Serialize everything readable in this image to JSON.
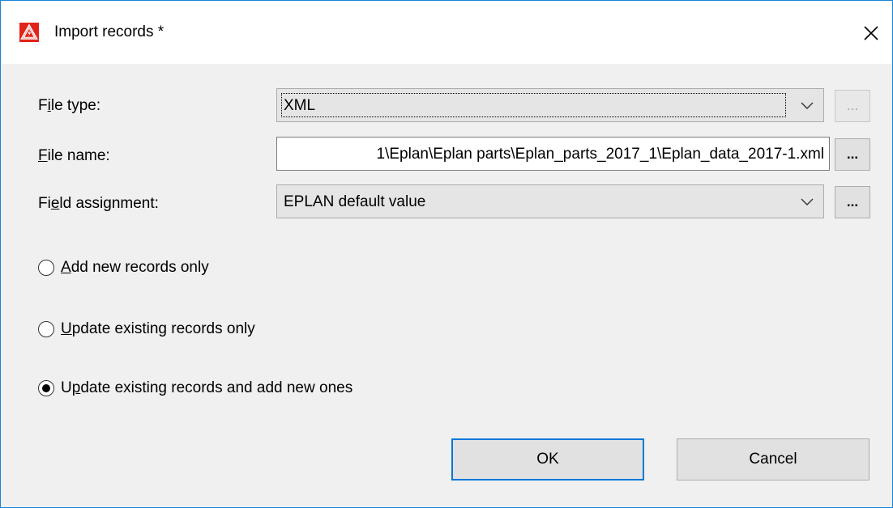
{
  "window": {
    "title": "Import records *",
    "accent_color": "#0078d7",
    "app_icon": "eplan-warning-icon",
    "close_icon": "close-icon"
  },
  "form": {
    "file_type": {
      "label_pre": "F",
      "label_u": "i",
      "label_post": "le type:",
      "value": "XML",
      "browse_label": "..."
    },
    "file_name": {
      "label_pre": "",
      "label_u": "F",
      "label_post": "ile name:",
      "value": "1\\Eplan\\Eplan parts\\Eplan_parts_2017_1\\Eplan_data_2017-1.xml",
      "browse_label": "..."
    },
    "field_assignment": {
      "label_pre": "Fi",
      "label_u": "e",
      "label_post": "ld assignment:",
      "value": "EPLAN default value",
      "browse_label": "..."
    }
  },
  "options": [
    {
      "pre": "",
      "u": "A",
      "post": "dd new records only",
      "selected": false
    },
    {
      "pre": "",
      "u": "U",
      "post": "pdate existing records only",
      "selected": false
    },
    {
      "pre": "U",
      "u": "p",
      "post": "date existing records and add new ones",
      "selected": true
    }
  ],
  "buttons": {
    "ok": "OK",
    "cancel": "Cancel"
  }
}
